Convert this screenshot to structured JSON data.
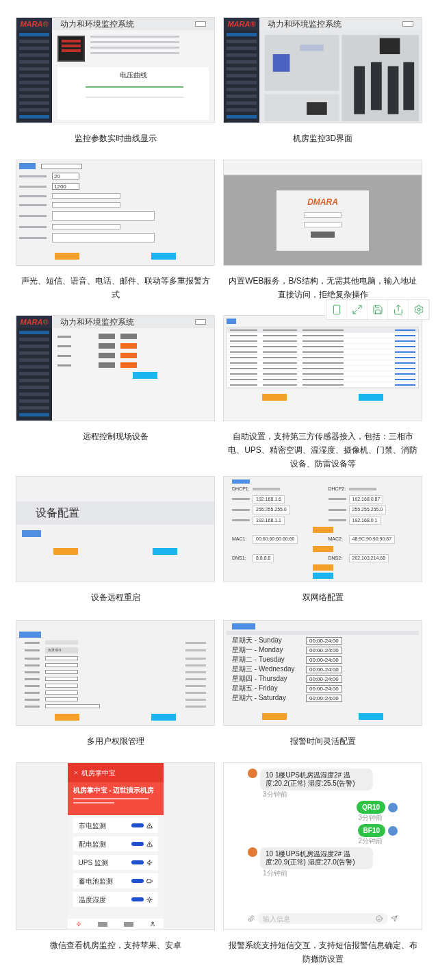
{
  "panels": [
    {
      "kind": "dashboard",
      "logo": "MARA®",
      "title": "动力和环境监控系统",
      "chart_title": "电压曲线",
      "caption": "监控参数实时曲线显示"
    },
    {
      "kind": "room3d",
      "logo": "MARA®",
      "title": "动力和环境监控系统",
      "caption": "机房监控3D界面"
    },
    {
      "kind": "alarm_form",
      "values": [
        "20",
        "1200"
      ],
      "caption": "声光、短信、语音、电话、邮件、联动等多重报警方式"
    },
    {
      "kind": "login",
      "logo": "DMARA",
      "caption": "内置WEB服务，B/S结构，无需其他电脑，输入地址直接访问，拒绝复杂操作"
    },
    {
      "kind": "control",
      "logo": "MARA®",
      "title": "动力和环境监控系统",
      "caption": "远程控制现场设备"
    },
    {
      "kind": "sensor_table",
      "caption": "自助设置，支持第三方传感器接入，包括：三相市电、UPS、精密空调、温湿度、摄像机、门禁、消防设备、防雷设备等"
    },
    {
      "kind": "restart",
      "heading": "设备配置",
      "caption": "设备远程重启"
    },
    {
      "kind": "network",
      "pairs": [
        {
          "left": {
            "label": "DHCP1:"
          },
          "right": {
            "label": "DHCP2:"
          }
        },
        {
          "left": {
            "value": "192.168.1.6"
          },
          "right": {
            "value": "192.168.0.87"
          }
        },
        {
          "left": {
            "value": "255.255.255.0"
          },
          "right": {
            "value": "255.255.255.0"
          }
        },
        {
          "left": {
            "value": "192.168.1.1"
          },
          "right": {
            "value": "192.168.0.1"
          }
        },
        {
          "left": {
            "label": "MAC1:",
            "value": "00:60:60:60:60:60"
          },
          "right": {
            "label": "MAC2:",
            "value": "48:9C:90:90:90:87"
          }
        },
        {
          "left": {
            "label": "DNS1:",
            "value": "8.8.8.8"
          },
          "right": {
            "label": "DNS2:",
            "value": "202.103.214.68"
          }
        }
      ],
      "caption": "双网络配置"
    },
    {
      "kind": "users",
      "login_name": "admin",
      "caption": "多用户权限管理"
    },
    {
      "kind": "schedule",
      "days": [
        {
          "day": "星期天 - Sunday",
          "time": "00:00-24:00"
        },
        {
          "day": "星期一 - Monday",
          "time": "00:00-24:00"
        },
        {
          "day": "星期二 - Tuesday",
          "time": "00:00-24:00"
        },
        {
          "day": "星期三 - Wednesday",
          "time": "00:00-24:00"
        },
        {
          "day": "星期四 - Thursday",
          "time": "00:00-24:00"
        },
        {
          "day": "星期五 - Friday",
          "time": "00:00-24:00"
        },
        {
          "day": "星期六 - Saturday",
          "time": "00:00-24:00"
        }
      ],
      "caption": "报警时间灵活配置"
    },
    {
      "kind": "phone",
      "nav_title": "机房掌中宝",
      "title": "机房掌中宝 - 迈世演示机房",
      "items": [
        "市电监测",
        "配电监测",
        "UPS 监测",
        "蓄电池监测",
        "温度湿度"
      ],
      "caption": "微信查看机房监控，支持苹果、安卓"
    },
    {
      "kind": "chat",
      "messages": [
        {
          "kind": "incoming",
          "text": "10 1楼UPS机房温湿度2# 温度:20.2(正常) 湿度:25.5(告警)",
          "time": "3分钟前"
        },
        {
          "kind": "outgoing",
          "text": "QR10",
          "time": "3分钟前"
        },
        {
          "kind": "outgoing",
          "text": "BF10",
          "time": "2分钟前"
        },
        {
          "kind": "incoming",
          "text": "10 1楼UPS机房温湿度2# 温度:20.9(正常) 湿度:27.0(告警)",
          "time": "1分钟前"
        }
      ],
      "placeholder": "输入信息",
      "caption": "报警系统支持短信交互，支持短信报警信息确定、布防撤防设置"
    }
  ]
}
